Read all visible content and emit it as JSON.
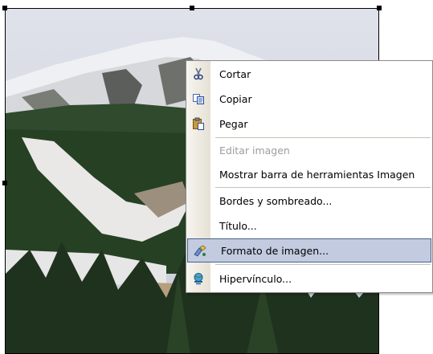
{
  "menu": {
    "items": [
      {
        "label": "Cortar",
        "icon": "scissors-icon",
        "enabled": true,
        "highlighted": false
      },
      {
        "label": "Copiar",
        "icon": "copy-icon",
        "enabled": true,
        "highlighted": false
      },
      {
        "label": "Pegar",
        "icon": "paste-icon",
        "enabled": true,
        "highlighted": false
      },
      {
        "label": "Editar imagen",
        "icon": "",
        "enabled": false,
        "highlighted": false
      },
      {
        "label": "Mostrar barra de herramientas Imagen",
        "icon": "",
        "enabled": true,
        "highlighted": false
      },
      {
        "label": "Bordes y sombreado...",
        "icon": "",
        "enabled": true,
        "highlighted": false
      },
      {
        "label": "Título...",
        "icon": "",
        "enabled": true,
        "highlighted": false
      },
      {
        "label": "Formato de imagen...",
        "icon": "format-picture-icon",
        "enabled": true,
        "highlighted": true
      },
      {
        "label": "Hipervínculo...",
        "icon": "hyperlink-icon",
        "enabled": true,
        "highlighted": false
      }
    ]
  },
  "colors": {
    "highlight_bg": "#c2cbe0",
    "highlight_border": "#4b5f8d",
    "disabled_text": "#9d9d9d"
  }
}
